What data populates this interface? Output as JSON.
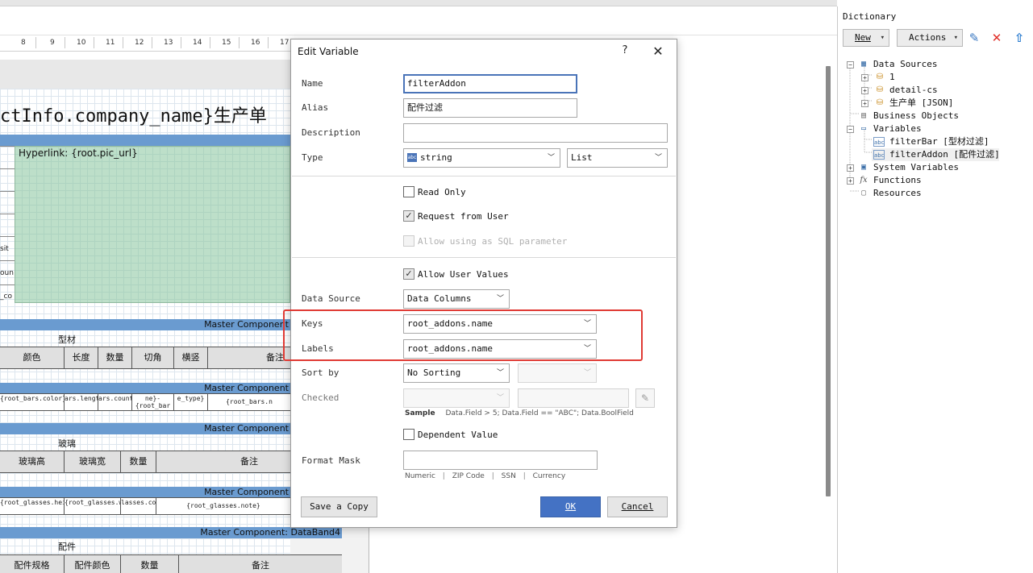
{
  "ruler": {
    "ticks": [
      "8",
      "9",
      "10",
      "11",
      "12",
      "13",
      "14",
      "15",
      "16",
      "17"
    ]
  },
  "report": {
    "title": "ctInfo.company_name}生产单",
    "hyperlink_label": "Hyperlink: {root.pic_url}",
    "left_fragments": [
      "sit",
      "oun",
      "_co"
    ],
    "band_headers": [
      "Master Component",
      "Master Component",
      "Master Component",
      "Master Component",
      "Master Component: DataBand4"
    ],
    "sections": {
      "bars": "型材",
      "glass": "玻璃",
      "addons": "配件"
    },
    "bars_headers": [
      "颜色",
      "长度",
      "数量",
      "切角",
      "横竖",
      "备注"
    ],
    "bars_data": [
      "{root_bars.color}",
      "ars.length}",
      "ars.count}",
      "ne}-{root_bar",
      "e_type}",
      "{root_bars.n"
    ],
    "glass_headers": [
      "玻璃高",
      "玻璃宽",
      "数量",
      "备注"
    ],
    "glass_data": [
      "{root_glasses.height}",
      "{root_glasses.width}",
      "lasses.count}",
      "{root_glasses.note}"
    ],
    "addons_headers": [
      "配件规格",
      "配件颜色",
      "数量",
      "备注"
    ]
  },
  "dictionary": {
    "title": "Dictionary",
    "new_label": "New",
    "actions_label": "Actions",
    "tree": {
      "data_sources": "Data Sources",
      "ds_items": [
        "1",
        "detail-cs",
        "生产单 [JSON]"
      ],
      "business_objects": "Business Objects",
      "variables": "Variables",
      "var_items": [
        "filterBar [型材过滤]",
        "filterAddon [配件过滤]"
      ],
      "system_variables": "System Variables",
      "functions": "Functions",
      "resources": "Resources"
    }
  },
  "dialog": {
    "title": "Edit Variable",
    "help": "?",
    "close": "✕",
    "labels": {
      "name": "Name",
      "alias": "Alias",
      "description": "Description",
      "type": "Type",
      "data_source": "Data Source",
      "keys": "Keys",
      "labels": "Labels",
      "sort_by": "Sort by",
      "checked": "Checked",
      "format_mask": "Format Mask"
    },
    "values": {
      "name": "filterAddon",
      "alias": "配件过滤",
      "description": "",
      "type": "string",
      "type_kind": "List",
      "data_source": "Data Columns",
      "keys": "root_addons.name",
      "labels": "root_addons.name",
      "sort_by": "No Sorting",
      "format_mask": ""
    },
    "checks": {
      "read_only": "Read Only",
      "request_from_user": "Request from User",
      "allow_sql": "Allow using as SQL parameter",
      "allow_user_values": "Allow User Values",
      "dependent_value": "Dependent Value"
    },
    "sample": {
      "label": "Sample",
      "text": "Data.Field > 5; Data.Field == \"ABC\"; Data.BoolField"
    },
    "format_hints": [
      "Numeric",
      "|",
      "ZIP Code",
      "|",
      "SSN",
      "|",
      "Currency"
    ],
    "buttons": {
      "save_copy": "Save a Copy",
      "ok": "OK",
      "cancel": "Cancel"
    }
  },
  "colors": {
    "accent": "#4472c4",
    "highlight": "#e03a34",
    "band": "#6a9bd0"
  }
}
